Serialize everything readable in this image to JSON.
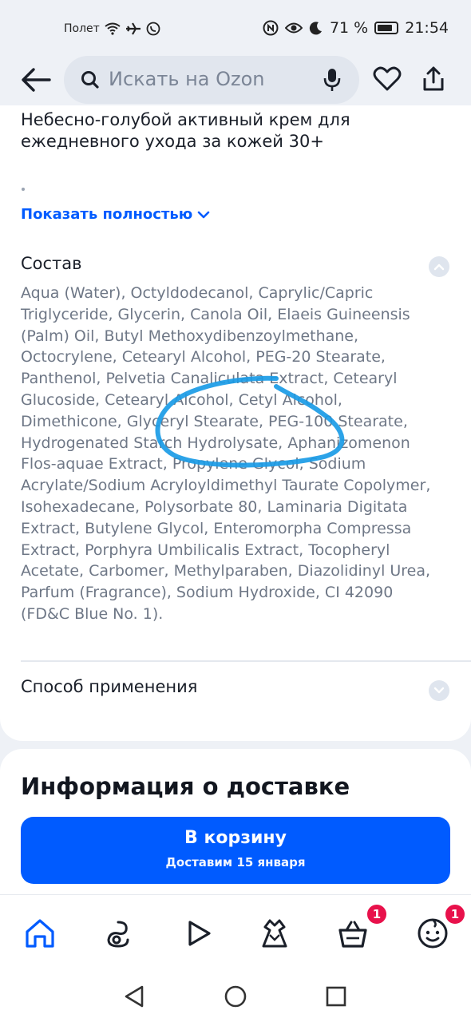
{
  "status_bar": {
    "mode": "Полет",
    "battery": "71 %",
    "time": "21:54"
  },
  "header": {
    "search_placeholder": "Искать на Ozon"
  },
  "product": {
    "description_title": "Небесно-голубой активный крем для ежедневного ухода за кожей 30+",
    "show_more": "Показать полностью"
  },
  "composition": {
    "title": "Состав",
    "text": "Aqua (Water), Octyldodecanol, Caprylic/Capric Triglyceride, Glycerin, Canola Oil, Elaeis Guineensis (Palm) Oil, Butyl Methoxydibenzoylmethane, Octocrylene, Cetearyl Alcohol, PEG-20 Stearate, Panthenol, Pelvetia Canaliculata Extract, Cetearyl Glucoside, Cetearyl Alcohol, Cetyl Alcohol, Dimethicone, Glyceryl Stearate, PEG-100 Stearate, Hydrogenated Starch Hydrolysate, Aphanizomenon Flos-aquae Extract, Propylene Glycol, Sodium Acrylate/Sodium Acryloyldimethyl Taurate Copolymer, Isohexadecane, Polysorbate 80, Laminaria Digitata Extract, Butylene Glycol, Enteromorpha Compressa Extract, Porphyra Umbilicalis Extract, Tocopheryl Acetate, Carbomer, Methylparaben, Diazolidinyl Urea, Parfum (Fragrance), Sodium Hydroxide, CI 42090 (FD&C Blue No. 1)."
  },
  "usage": {
    "title": "Способ применения"
  },
  "delivery": {
    "title": "Информация о доставке",
    "cart_label": "В корзину",
    "cart_sub": "Доставим 15 января"
  },
  "bottom_nav": {
    "cart_badge": "1",
    "profile_badge": "1"
  },
  "colors": {
    "accent": "#005bff",
    "badge": "#e8114b",
    "scribble": "#1a9be6"
  }
}
